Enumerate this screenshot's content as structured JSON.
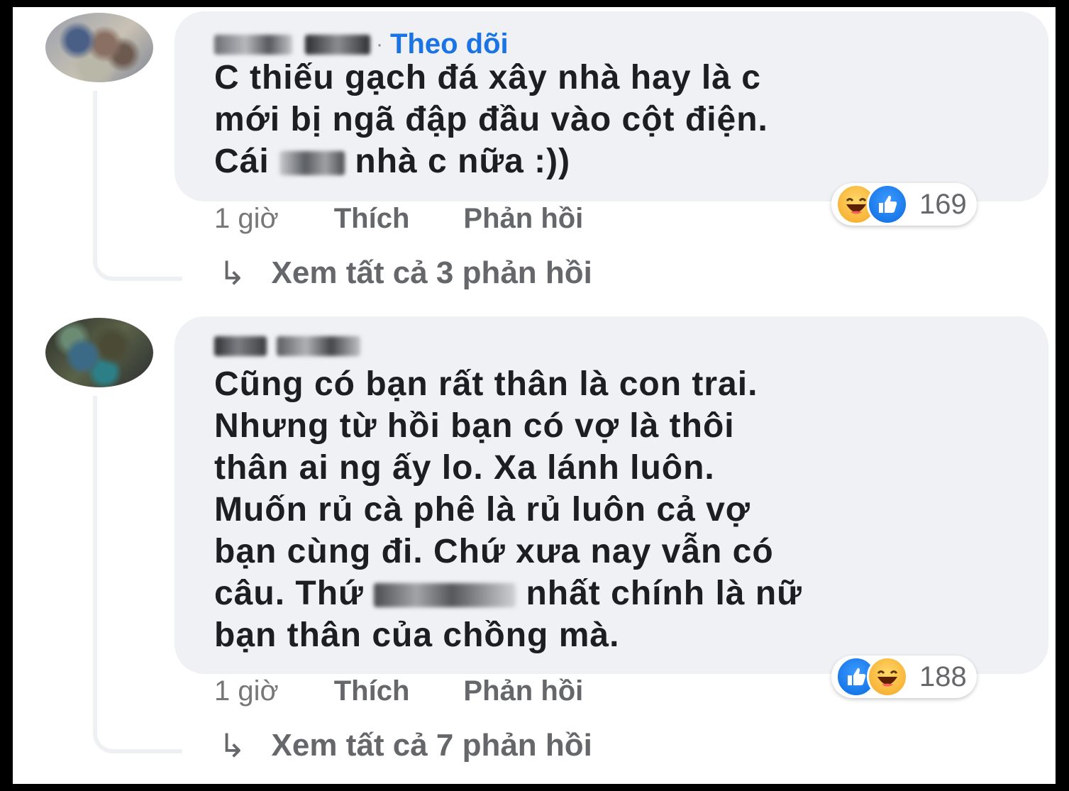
{
  "comments": [
    {
      "author_visible": "",
      "follow_label": "Theo dõi",
      "separator": "·",
      "text_before": "C thiếu gạch đá xây nhà hay là c\nmới bị ngã đập đầu vào cột điện.\nCái ",
      "text_after": " nhà c nữa :))",
      "time": "1 giờ",
      "like_label": "Thích",
      "reply_label": "Phản hồi",
      "reactions": [
        "haha",
        "like"
      ],
      "reaction_count": "169",
      "view_replies": "Xem tất cả 3 phản hồi"
    },
    {
      "author_visible": "",
      "text_before": "Cũng có bạn rất thân là con trai.\nNhưng từ hồi bạn có vợ là thôi\nthân ai ng ấy lo. Xa lánh luôn.\nMuốn rủ cà phê là rủ luôn cả vợ\nbạn cùng đi. Chứ xưa nay vẫn có\ncâu. Thứ ",
      "text_after": " nhất chính là nữ\nbạn thân của chồng mà.",
      "time": "1 giờ",
      "like_label": "Thích",
      "reply_label": "Phản hồi",
      "reactions": [
        "like",
        "haha"
      ],
      "reaction_count": "188",
      "view_replies": "Xem tất cả 7 phản hồi"
    }
  ],
  "icons": {
    "reply_arrow": "↳",
    "haha": "haha-reaction-icon",
    "like": "like-reaction-icon"
  },
  "colors": {
    "bubble": "#eff1f4",
    "follow": "#1b74e4",
    "secondary_text": "#65676b",
    "like": "#0a6ae0",
    "haha": "#f5a623"
  }
}
